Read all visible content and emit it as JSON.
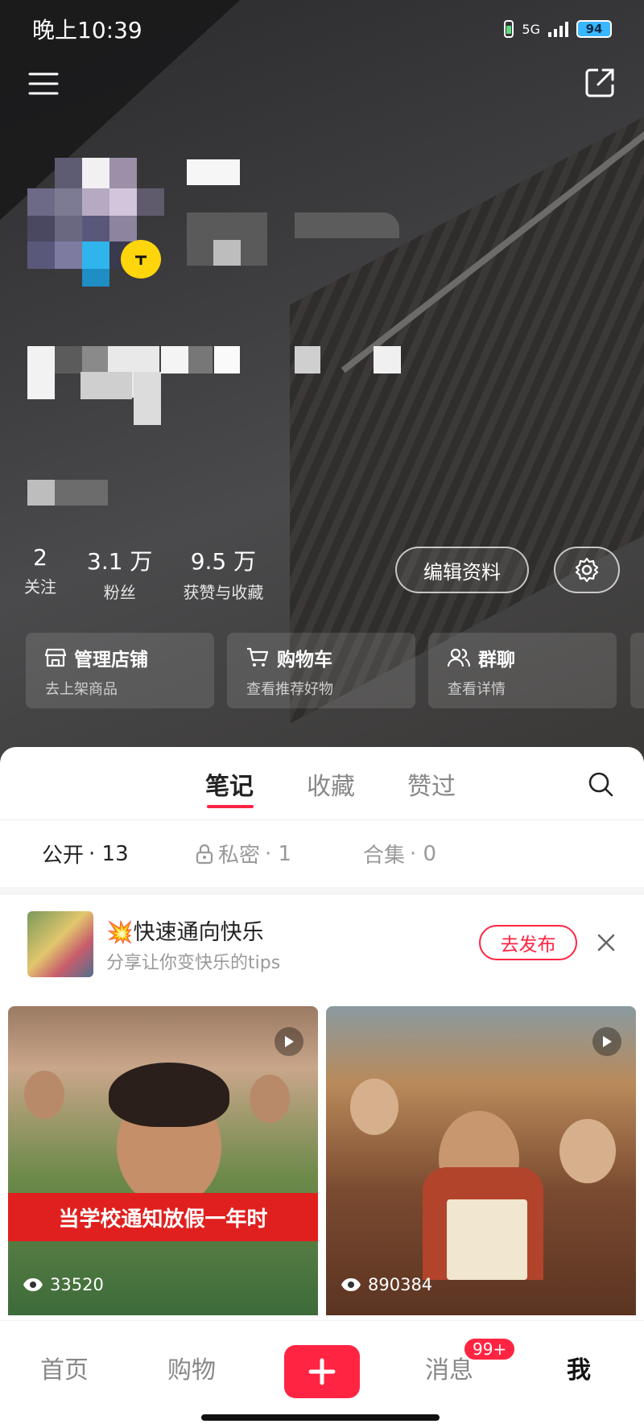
{
  "status_bar": {
    "time": "晚上10:39",
    "network": "5G",
    "battery": "94"
  },
  "profile_stats": [
    {
      "value": "2",
      "label": "关注"
    },
    {
      "value": "3.1 万",
      "label": "粉丝"
    },
    {
      "value": "9.5 万",
      "label": "获赞与收藏"
    }
  ],
  "actions": {
    "edit_profile": "编辑资料"
  },
  "shortcuts": [
    {
      "title": "管理店铺",
      "subtitle": "去上架商品",
      "icon": "store-icon"
    },
    {
      "title": "购物车",
      "subtitle": "查看推荐好物",
      "icon": "cart-icon"
    },
    {
      "title": "群聊",
      "subtitle": "查看详情",
      "icon": "group-icon"
    }
  ],
  "tabs": [
    "笔记",
    "收藏",
    "赞过"
  ],
  "subtabs": [
    {
      "label": "公开",
      "count": "· 13"
    },
    {
      "label": "私密",
      "count": "· 1"
    },
    {
      "label": "合集",
      "count": "· 0"
    }
  ],
  "promo": {
    "title": "💥快速通向快乐",
    "subtitle": "分享让你变快乐的tips",
    "button": "去发布"
  },
  "notes": [
    {
      "overlay_text": "当学校通知放假一年时",
      "views": "33520"
    },
    {
      "overlay_text": "",
      "views": "890384"
    }
  ],
  "bottom_nav": {
    "home": "首页",
    "shopping": "购物",
    "messages": "消息",
    "me": "我",
    "badge": "99+"
  },
  "colors": {
    "accent": "#ff2442"
  }
}
